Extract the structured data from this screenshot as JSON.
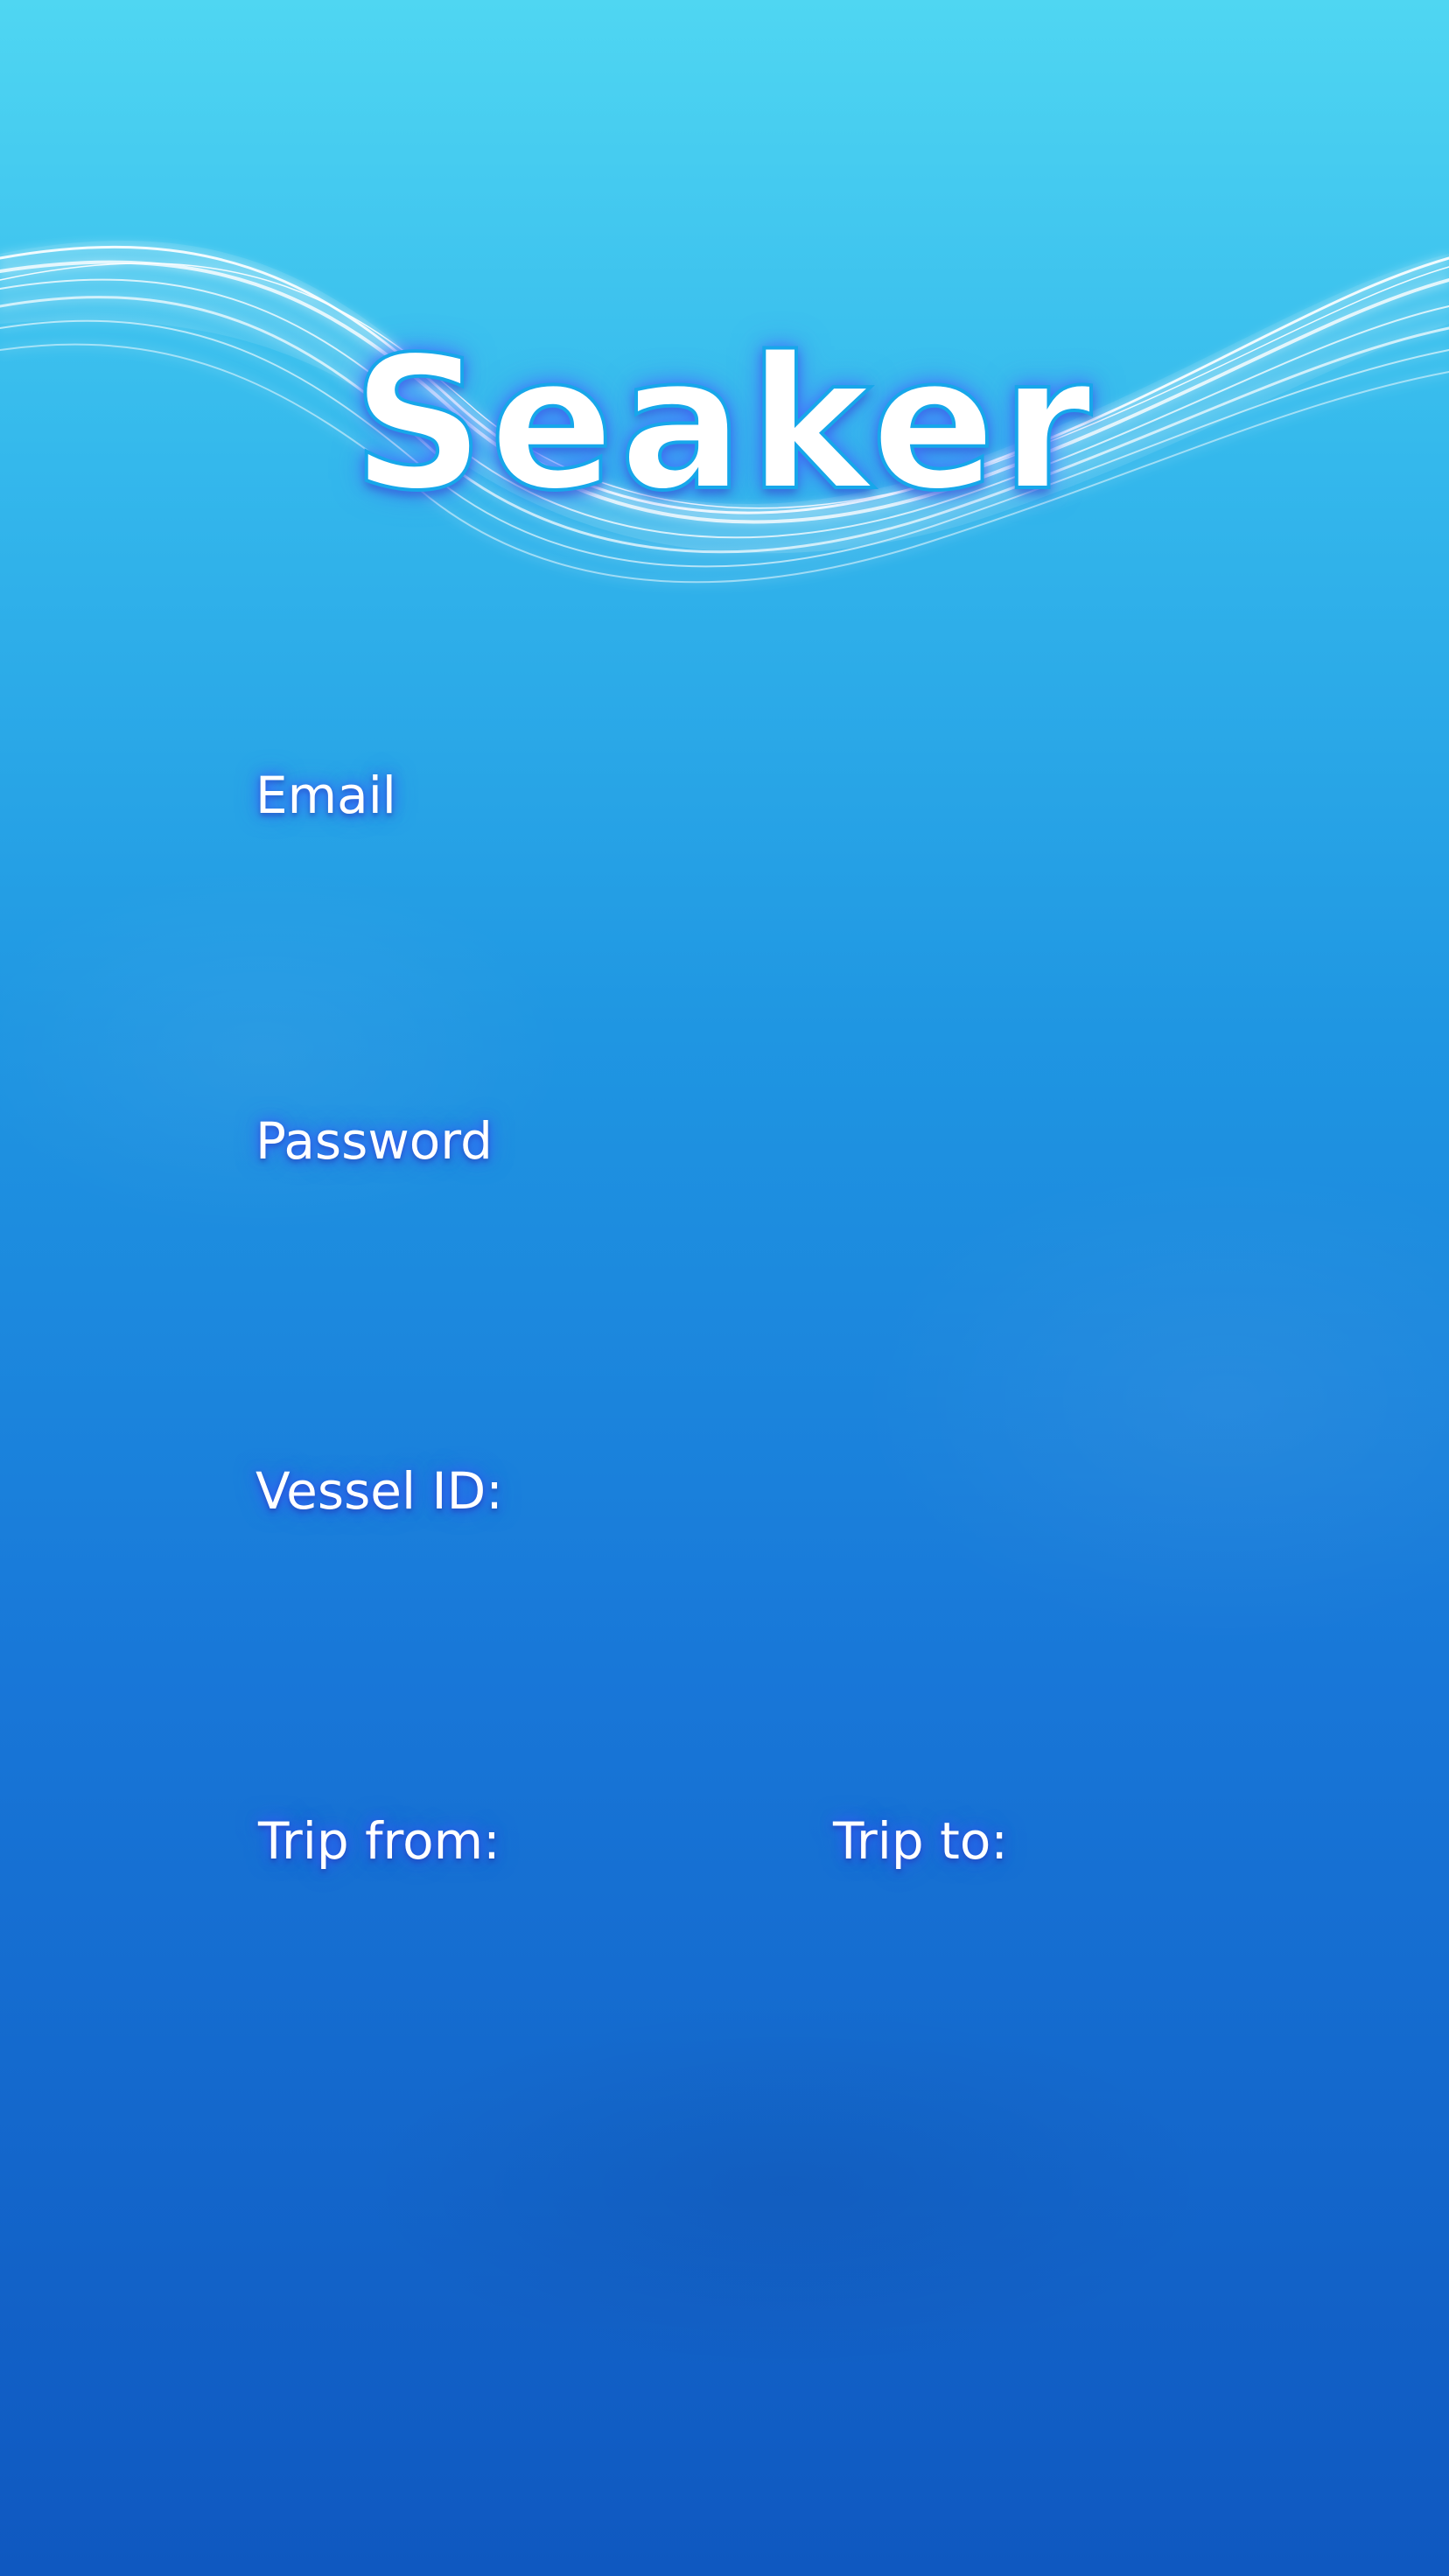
{
  "app": {
    "title": "Seaker"
  },
  "form": {
    "email": {
      "label": "Email",
      "value": ""
    },
    "password": {
      "label": "Password",
      "value": ""
    },
    "vessel_id": {
      "label": "Vessel ID:",
      "value": ""
    },
    "trip_from": {
      "label": "Trip from:",
      "value": ""
    },
    "trip_to": {
      "label": "Trip to:",
      "value": ""
    }
  },
  "colors": {
    "background_top": "#4fd6f2",
    "background_bottom": "#0f58c0",
    "text": "#ffffff",
    "glow": "#3c5aff"
  },
  "icons": {
    "header_decoration": "light-wave-graphic"
  }
}
